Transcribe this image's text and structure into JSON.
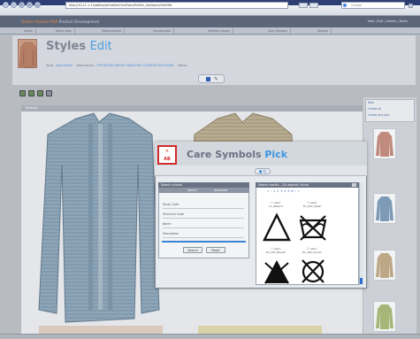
{
  "browser": {
    "url": "http://10.11.1.10/dbExpl/sFxdDIn01ed?sdurPs03m_0id/bpnn/Vid03fd",
    "search_placeholder": "Google"
  },
  "app": {
    "name_accent": "Gerber Fashion PLM",
    "name_rest": "Product Development",
    "top_right": "Help | Exit | Admin | Tasks"
  },
  "menu": [
    "Styles",
    "Fabric Spec",
    "Measurement",
    "Construction",
    "Material Library",
    "Care Symbols",
    "Reports"
  ],
  "styles_header": {
    "title": "Styles",
    "edit": "Edit",
    "row_label_1": "Style",
    "row_value_1": "Style Detail",
    "row_label_2": "Description:",
    "row_value_2": "TOP JERSEY JERSEY MANCHES COURTES ENCOLURE",
    "row_label_3": "Status",
    "save_icon": "save-icon",
    "edit_icon": "pencil-icon"
  },
  "toolbar_icons": [
    "new-icon",
    "copy-icon",
    "print-icon",
    "delete-icon"
  ],
  "pictures": {
    "title": "Pictures"
  },
  "sidebar_links": [
    "New",
    "Create all",
    "Create and pick"
  ],
  "dialog": {
    "logo_text": "AB",
    "title": "Care Symbols",
    "pick": "Pick",
    "strip_buttons": "◼ ↻",
    "criteria": {
      "title": "Search criteria",
      "tab1": "Search",
      "tab2": "Advanced",
      "fields": [
        "Study Code",
        "Technical Code",
        "Name",
        "Description"
      ],
      "search_button": "Search",
      "reset_button": "Reset"
    },
    "results": {
      "title": "Search results - (24 objects) found",
      "pager": "« ‹ 1 2 3 4 5 6 › »",
      "items": [
        {
          "code": "no_Bleach",
          "caption": "☐ selec"
        },
        {
          "code": "Do_Not_Wash",
          "caption": "☐ selec"
        },
        {
          "code": "Do_Not_Bleach",
          "caption": "☐ selec"
        },
        {
          "code": "Do_Not_Drycln",
          "caption": "☐ selec"
        }
      ]
    }
  },
  "colors": {
    "accent": "#3d96e1",
    "brand_orange": "#eb8b3a",
    "header": "#5c667a",
    "logo_red": "#d12929"
  }
}
